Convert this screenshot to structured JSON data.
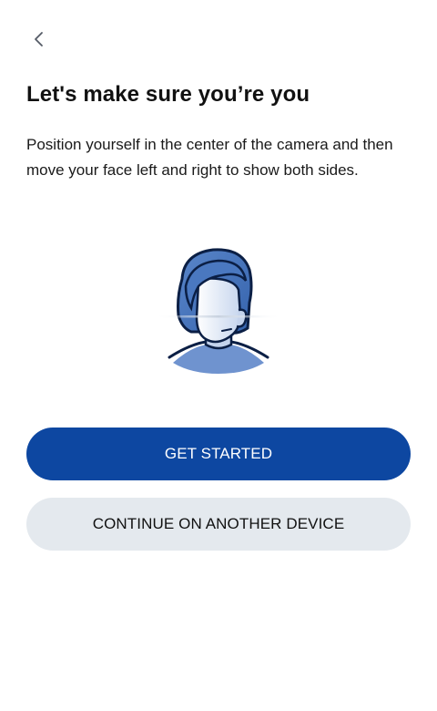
{
  "header": {
    "back_icon": "chevron-left-icon"
  },
  "main": {
    "title": "Let's make sure you’re you",
    "instructions": "Position yourself in the center of the camera and then move your face left and right to show both sides.",
    "illustration_icon": "face-scan-illustration"
  },
  "actions": {
    "primary_label": "GET STARTED",
    "secondary_label": "CONTINUE ON ANOTHER DEVICE"
  },
  "colors": {
    "primary": "#0d47a1",
    "secondary_bg": "#e4e9ee",
    "illustration_blue": "#3f6fb8",
    "illustration_light": "#dbe6f5"
  }
}
